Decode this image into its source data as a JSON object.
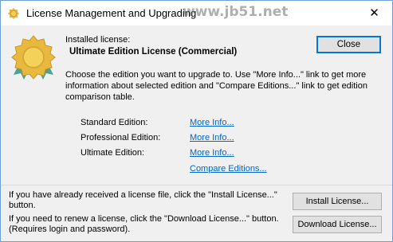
{
  "window": {
    "title": "License Management and Upgrading",
    "watermark": "www.jb51.net",
    "close_glyph": "✕",
    "icon": "license-badge-icon"
  },
  "license": {
    "installed_label": "Installed license:",
    "name": "Ultimate Edition License (Commercial)",
    "badge_icon": "award-ribbon-icon",
    "badge_colors": {
      "outer": "#e8b93d",
      "inner": "#f4d25a",
      "ribbon": "#4fa38e"
    }
  },
  "close_button": {
    "label": "Close"
  },
  "description": "Choose the edition you want to upgrade to. Use \"More Info...\" link to get more information about selected edition and \"Compare Editions...\" link to get edition comparison table.",
  "editions": [
    {
      "label": "Standard Edition:",
      "link": "More Info..."
    },
    {
      "label": "Professional Edition:",
      "link": "More Info..."
    },
    {
      "label": "Ultimate Edition:",
      "link": "More Info..."
    }
  ],
  "compare_link": "Compare Editions...",
  "footer": {
    "install_text": "If you have already received a license file, click the \"Install License...\" button.",
    "install_button": "Install License...",
    "download_text": "If you need to renew a license, click the \"Download License...\" button. (Requires login and password).",
    "download_button": "Download License..."
  },
  "colors": {
    "link": "#0066cc",
    "focus_border": "#0078d7",
    "client_bg": "#f0f0f0"
  }
}
